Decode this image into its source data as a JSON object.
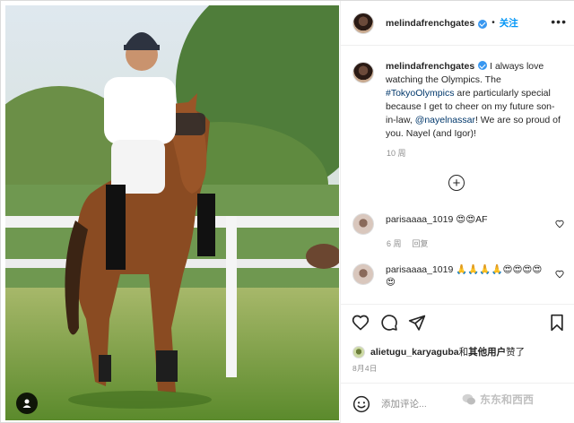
{
  "post": {
    "username": "melindafrenchgates",
    "separator": "•",
    "follow_label": "关注",
    "more_label": "•••",
    "caption": {
      "username": "melindafrenchgates",
      "text_1": " I always love watching the Olympics. The ",
      "hashtag": "#TokyoOlympics",
      "text_2": " are particularly special because I get to cheer on my future son-in-law, ",
      "mention": "@nayelnassar",
      "text_3": "! We are so proud of you. Nayel (and Igor)!"
    },
    "caption_time": "10 周"
  },
  "comments": [
    {
      "username": "parisaaaa_1019",
      "text": " 😍😍AF",
      "time": "6 周",
      "reply_label": "回复"
    },
    {
      "username": "parisaaaa_1019",
      "text": " 🙏🙏🙏🙏😍😍😍😍😍"
    }
  ],
  "likes": {
    "user": "alietugu_karyaguba",
    "middle": " 和 ",
    "others": "其他用户",
    "suffix": " 赞了"
  },
  "date": "8月4日",
  "comment_input": {
    "placeholder": "添加评论..."
  },
  "watermark": "东东和西西",
  "colors": {
    "accent": "#0095f6",
    "verified": "#3897f0",
    "muted": "#8e8e8e"
  },
  "icons": [
    "verified-badge-icon",
    "more-options-icon",
    "load-more-plus-icon",
    "heart-icon",
    "comment-icon",
    "share-icon",
    "bookmark-icon",
    "emoji-icon",
    "user-tag-icon"
  ]
}
